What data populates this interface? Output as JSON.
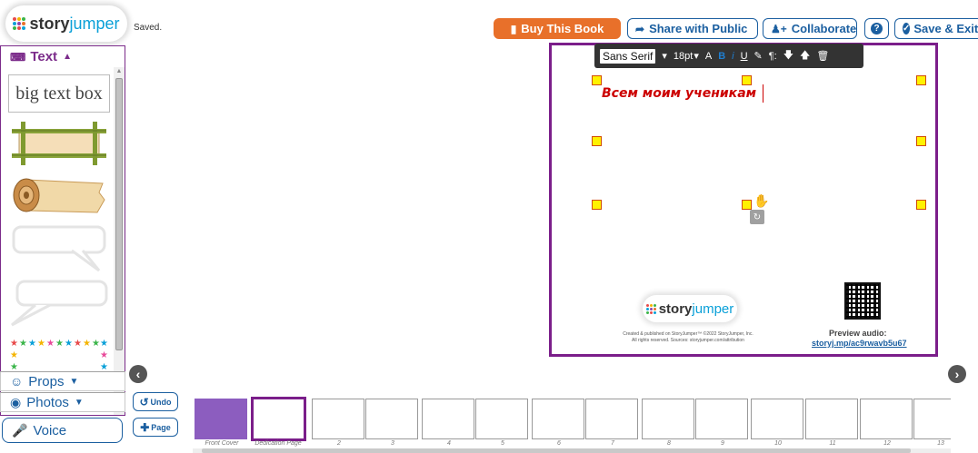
{
  "app": {
    "brand_part1": "story",
    "brand_part2": "jumper",
    "status": "Saved."
  },
  "topbar": {
    "buy_label": "Buy This Book",
    "share_label": "Share with Public",
    "collaborate_label": "Collaborate",
    "help_label": "?",
    "save_exit_label": "Save & Exit"
  },
  "sidebar": {
    "text_header": "Text",
    "bigtext_label": "big text box",
    "props_label": "Props",
    "photos_label": "Photos",
    "voice_label": "Voice"
  },
  "toolbar": {
    "font": "Sans Serif",
    "size": "18pt"
  },
  "page": {
    "text": "Всем моим ученикам",
    "brand_part1": "story",
    "brand_part2": "jumper",
    "credit_line1": "Created & published on StoryJumper™ ©2022 StoryJumper, Inc.",
    "credit_line2": "All rights reserved. Sources: storyjumper.com/attribution",
    "preview_label": "Preview audio:",
    "preview_link": "storyj.mp/ac9rwavb5u67"
  },
  "controls": {
    "undo_label": "Undo",
    "page_label": "Page"
  },
  "thumbnails": {
    "labels": [
      "Front Cover",
      "Dedication Page",
      "2",
      "3",
      "4",
      "5",
      "6",
      "7",
      "8",
      "9",
      "10",
      "11",
      "12",
      "13"
    ]
  },
  "colors": {
    "accent_purple": "#7b1e8a",
    "accent_blue": "#1b5fa0",
    "buy_orange": "#e8702a",
    "text_red": "#cc0000"
  }
}
